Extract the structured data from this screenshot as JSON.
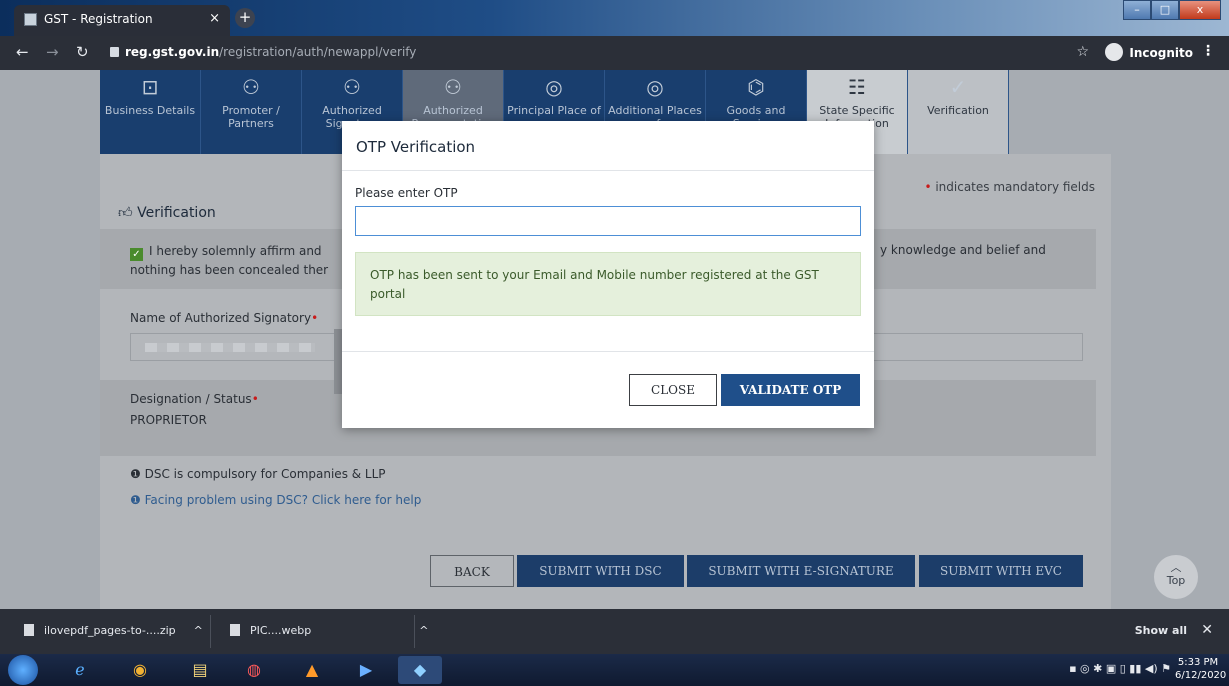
{
  "browser": {
    "tab_title": "GST - Registration",
    "tab_close": "×",
    "new_tab": "+",
    "url_host": "reg.gst.gov.in",
    "url_path": "/registration/auth/newappl/verify",
    "incognito_label": "Incognito",
    "window_min": "–",
    "window_max": "□",
    "window_close": "x"
  },
  "steps": [
    {
      "label": "Business Details",
      "icon": "briefcase-icon"
    },
    {
      "label": "Promoter / Partners",
      "icon": "person-icon"
    },
    {
      "label": "Authorized Signatory",
      "icon": "person-check-icon"
    },
    {
      "label": "Authorized Representative",
      "icon": "person-check-icon"
    },
    {
      "label": "Principal Place of",
      "icon": "location-pin-icon"
    },
    {
      "label": "Additional Places of",
      "icon": "location-pins-icon"
    },
    {
      "label": "Goods and Services",
      "icon": "tag-icon"
    },
    {
      "label": "State Specific Information",
      "icon": "form-icon"
    },
    {
      "label": "Verification",
      "icon": "check-circle-icon"
    }
  ],
  "page": {
    "section_title": "Verification",
    "mandatory_marker": "•",
    "mandatory_note": "indicates mandatory fields",
    "affirm_text": "I hereby solemnly affirm and",
    "affirm_text_2": "nothing has been concealed ther",
    "affirm_tail": "y knowledge and belief and",
    "name_label": "Name of Authorized Signatory",
    "designation_label": "Designation / Status",
    "designation_value": "PROPRIETOR",
    "dsc_note": "DSC is compulsory for Companies & LLP",
    "dsc_help": "Facing problem using DSC? Click here for help",
    "buttons": {
      "back": "BACK",
      "submit_dsc": "SUBMIT WITH DSC",
      "submit_esign": "SUBMIT WITH E-SIGNATURE",
      "submit_evc": "SUBMIT WITH EVC"
    },
    "top_label": "Top"
  },
  "modal": {
    "title": "OTP Verification",
    "otp_label": "Please enter OTP",
    "otp_value": "",
    "alert_text": "OTP has been sent to your Email and Mobile number registered at the GST portal",
    "close_label": "CLOSE",
    "validate_label": "VALIDATE OTP"
  },
  "downloads": {
    "items": [
      {
        "name": "ilovepdf_pages-to-....zip"
      },
      {
        "name": "PIC....webp"
      }
    ],
    "show_all": "Show all"
  },
  "taskbar": {
    "time": "5:33 PM",
    "date": "6/12/2020"
  }
}
